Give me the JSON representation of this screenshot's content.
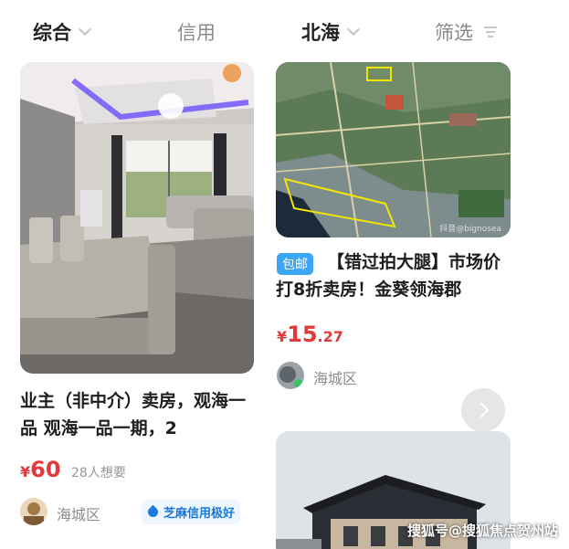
{
  "filters": {
    "sort_label": "综合",
    "credit_label": "信用",
    "location_label": "北海",
    "screen_label": "筛选"
  },
  "cards": [
    {
      "title": "业主（非中介）卖房，观海一品 观海一品一期，2",
      "price_symbol": "¥",
      "price_int": "60",
      "price_dec": "",
      "wants": "28人想要",
      "area": "海城区",
      "credit_badge": "芝麻信用极好"
    },
    {
      "badge": "包邮",
      "title": "【错过拍大腿】市场价打8折卖房！金葵领海郡",
      "price_symbol": "¥",
      "price_int": "15",
      "price_dec": ".27",
      "area": "海城区",
      "map_watermark": "抖音@bignosea"
    }
  ],
  "watermark": "搜狐号@搜狐焦点贺州站",
  "colors": {
    "price": "#e4393c",
    "badge_blue": "#3aa6f4",
    "credit_blue": "#1677d8"
  }
}
